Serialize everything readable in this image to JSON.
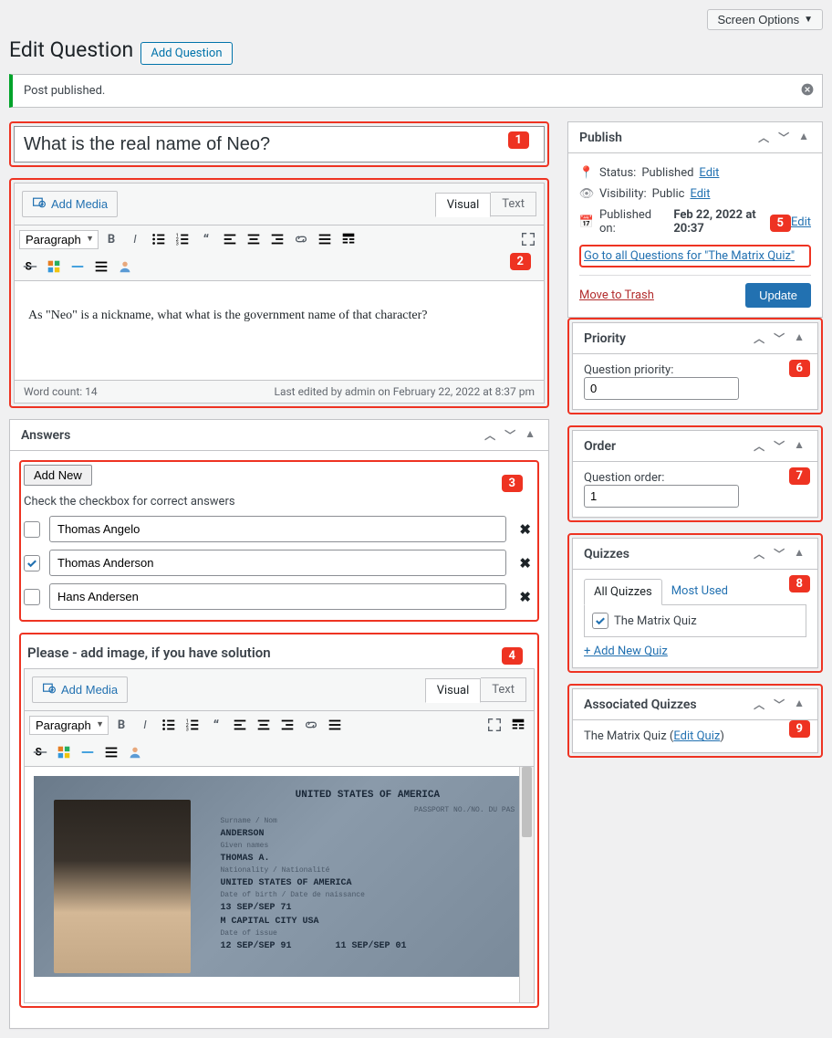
{
  "screen_options_label": "Screen Options",
  "page_title": "Edit Question",
  "add_question_label": "Add Question",
  "notice_text": "Post published.",
  "title_value": "What is the real name of Neo?",
  "editor": {
    "add_media": "Add Media",
    "visual_tab": "Visual",
    "text_tab": "Text",
    "paragraph": "Paragraph",
    "content": "As \"Neo\" is a nickname, what what is the government name of that character?",
    "word_count_label": "Word count: 14",
    "last_edit": "Last edited by admin on February 22, 2022 at 8:37 pm"
  },
  "answers": {
    "heading": "Answers",
    "add_new": "Add New",
    "help": "Check the checkbox for correct answers",
    "items": [
      {
        "text": "Thomas Angelo",
        "checked": false
      },
      {
        "text": "Thomas Anderson",
        "checked": true
      },
      {
        "text": "Hans Andersen",
        "checked": false
      }
    ]
  },
  "solution": {
    "title": "Please - add image, if you have solution",
    "passport": {
      "header": "UNITED STATES OF AMERICA",
      "subheader": "PASSPORT NO./NO. DU PAS",
      "surname_label": "Surname / Nom",
      "surname": "ANDERSON",
      "given_label": "Given names",
      "given": "THOMAS A.",
      "nat_label": "Nationality / Nationalité",
      "nat": "UNITED STATES OF AMERICA",
      "dob_label": "Date of birth / Date de naissance",
      "dob": "13 SEP/SEP 71",
      "sex_pob": "M     CAPITAL CITY    USA",
      "issue_label": "Date of issue",
      "issue": "12 SEP/SEP 91",
      "exp": "11 SEP/SEP 01"
    }
  },
  "publish": {
    "heading": "Publish",
    "status_label": "Status:",
    "status_value": "Published",
    "visibility_label": "Visibility:",
    "visibility_value": "Public",
    "published_label": "Published on:",
    "published_value": "Feb 22, 2022 at 20:37",
    "edit_label": "Edit",
    "goto_link": "Go to all Questions for \"The Matrix Quiz\"",
    "trash_label": "Move to Trash",
    "update_label": "Update"
  },
  "priority": {
    "heading": "Priority",
    "label": "Question priority:",
    "value": "0"
  },
  "order": {
    "heading": "Order",
    "label": "Question order:",
    "value": "1"
  },
  "quizzes": {
    "heading": "Quizzes",
    "tab_all": "All Quizzes",
    "tab_most": "Most Used",
    "item": "The Matrix Quiz",
    "add_new": "+ Add New Quiz"
  },
  "assoc": {
    "heading": "Associated Quizzes",
    "item": "The Matrix Quiz",
    "edit": "Edit Quiz"
  },
  "badges": {
    "b1": "1",
    "b2": "2",
    "b3": "3",
    "b4": "4",
    "b5": "5",
    "b6": "6",
    "b7": "7",
    "b8": "8",
    "b9": "9"
  }
}
